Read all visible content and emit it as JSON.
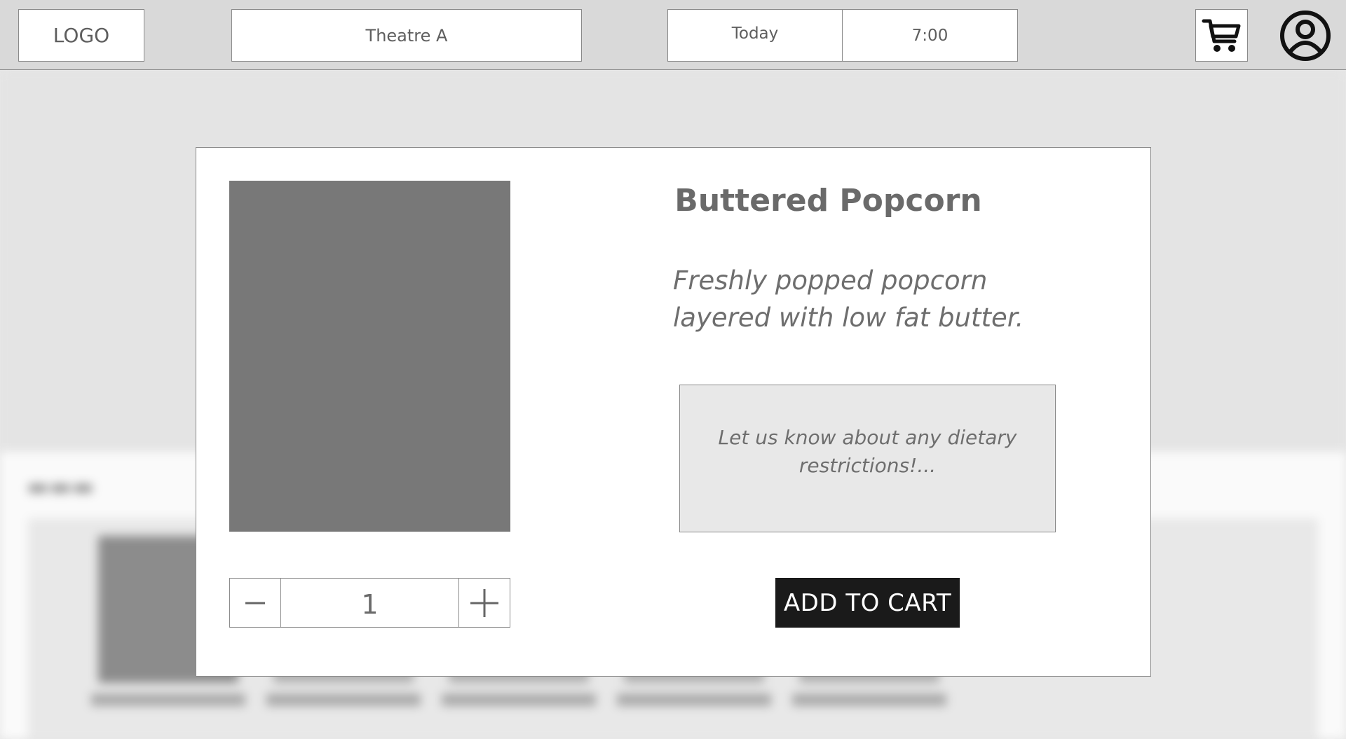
{
  "header": {
    "logo": "LOGO",
    "theatre": "Theatre A",
    "date": "Today",
    "time": "7:00",
    "cart_icon": "shopping-cart-icon",
    "profile_icon": "user-profile-icon"
  },
  "modal": {
    "title": "Buttered Popcorn",
    "description_line1": "Freshly popped popcorn",
    "description_line2": "layered with low fat butter.",
    "dietary_placeholder": "Let us know about any dietary restrictions!...",
    "quantity": "1",
    "add_to_cart": "ADD TO CART",
    "minus_icon": "minus-icon",
    "plus_icon": "plus-icon"
  },
  "colors": {
    "topbar": "#d9d9d9",
    "image_placeholder": "#787878",
    "primary_button": "#1a1a1a",
    "text_muted": "#6a6a6a"
  }
}
